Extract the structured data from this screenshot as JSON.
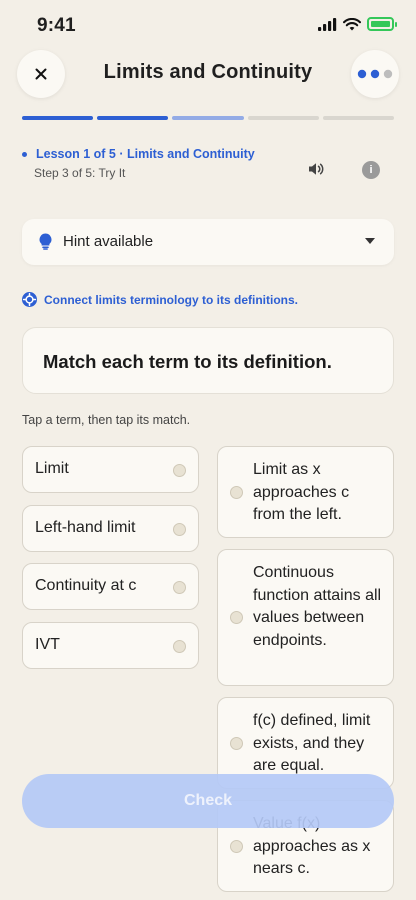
{
  "status": {
    "time": "9:41"
  },
  "header": {
    "title": "Limits and Continuity"
  },
  "progress": {
    "total_steps": 5,
    "completed_steps": 2,
    "current_step": 3
  },
  "lesson": {
    "line": "Lesson 1 of 5 · Limits and Continuity",
    "step": "Step 3 of 5: Try It"
  },
  "hint": {
    "label": "Hint available"
  },
  "objective": "Connect limits terminology to its definitions.",
  "prompt": "Match each term to its definition.",
  "instruction": "Tap a term, then tap its match.",
  "terms": [
    "Limit",
    "Left-hand limit",
    "Continuity at c",
    "IVT"
  ],
  "definitions": [
    "Limit as x approaches c from the left.",
    "Continuous function attains all values between endpoints.",
    "f(c) defined, limit exists, and they are equal.",
    "Value f(x) approaches as x nears c."
  ],
  "actions": {
    "check_label": "Check"
  },
  "colors": {
    "accent": "#2d5fd3",
    "background": "#f3efe7",
    "check_disabled": "#b4c9f6"
  }
}
